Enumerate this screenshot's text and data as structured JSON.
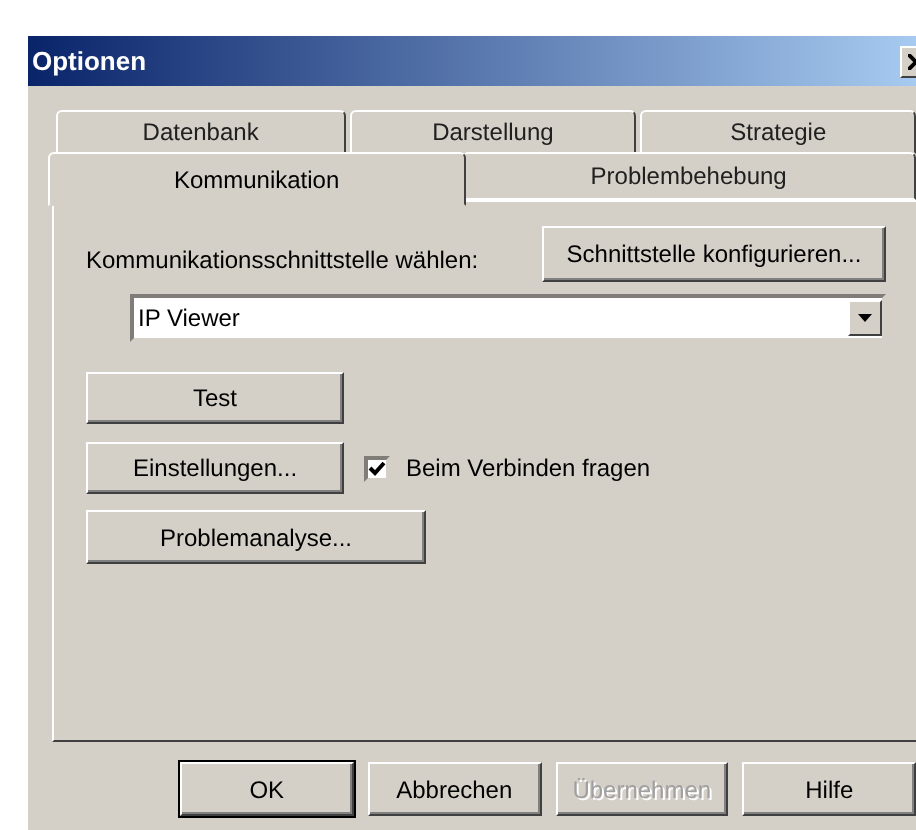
{
  "window": {
    "title": "Optionen"
  },
  "tab_rows": [
    [
      {
        "label": "Datenbank",
        "selected": false
      },
      {
        "label": "Darstellung",
        "selected": false
      },
      {
        "label": "Strategie",
        "selected": false
      }
    ],
    [
      {
        "label": "Kommunikation",
        "selected": true
      },
      {
        "label": "Problembehebung",
        "selected": false
      }
    ]
  ],
  "interface": {
    "label": "Kommunikationsschnittstelle wählen:",
    "configure_button": "Schnittstelle konfigurieren...",
    "combobox": {
      "value": "IP Viewer"
    }
  },
  "test_button": "Test",
  "settings_button": "Einstellungen...",
  "ask_on_connect": {
    "label": "Beim Verbinden fragen",
    "checked": true
  },
  "analysis_button": "Problemanalyse...",
  "footer_buttons": [
    {
      "label": "OK",
      "default": true,
      "disabled": false
    },
    {
      "label": "Abbrechen",
      "default": false,
      "disabled": false
    },
    {
      "label": "Übernehmen",
      "default": false,
      "disabled": true
    },
    {
      "label": "Hilfe",
      "default": false,
      "disabled": false
    }
  ]
}
